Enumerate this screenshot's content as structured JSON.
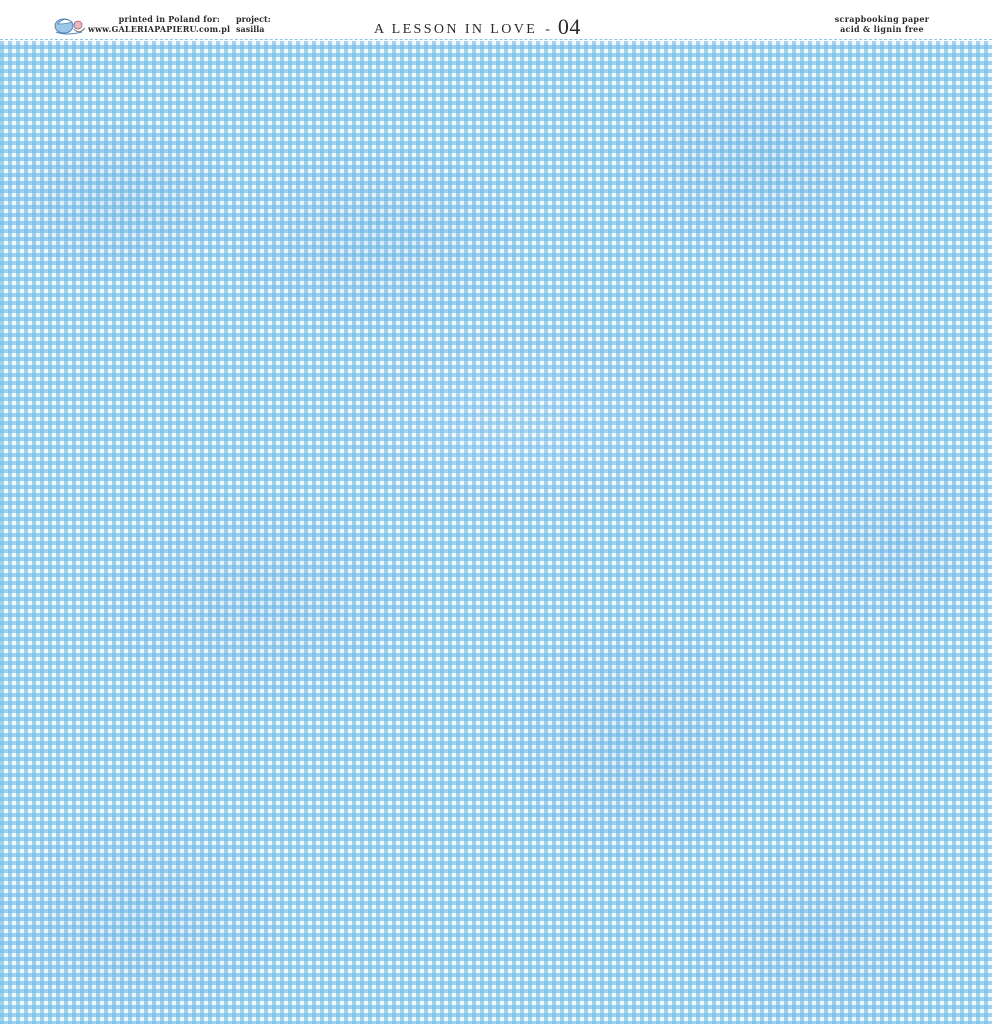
{
  "header": {
    "printed_line1": "printed in Poland for:",
    "printed_line2": "www.GALERIAPAPIERU.com.pl",
    "project_label": "project:",
    "project_name": "sasilla",
    "title": "A LESSON IN LOVE",
    "title_separator": "-",
    "title_number": "04",
    "paper_line1": "scrapbooking paper",
    "paper_line2": "acid & lignin free",
    "logo_icon": "galeria-papieru-logo-icon"
  },
  "colors": {
    "gingham_blue": "#70bae6",
    "gingham_light": "#eef8fd",
    "cut_line": "#8fc4e6",
    "text": "#2b2b2b"
  }
}
